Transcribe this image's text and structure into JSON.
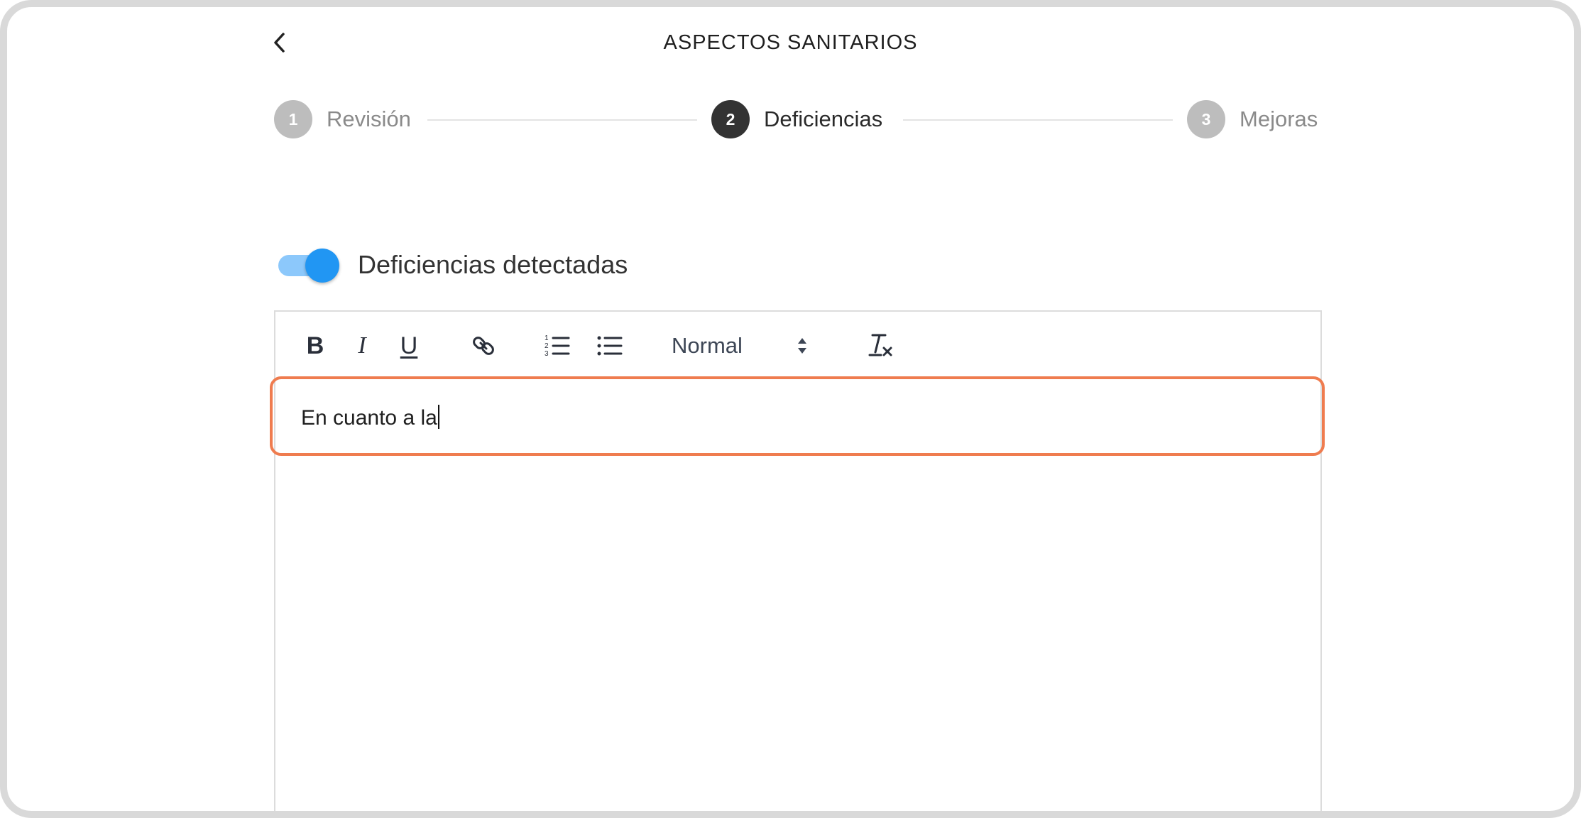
{
  "header": {
    "title": "ASPECTOS SANITARIOS",
    "back_icon": "chevron-left-icon"
  },
  "stepper": {
    "steps": [
      {
        "number": "1",
        "label": "Revisión",
        "state": "inactive"
      },
      {
        "number": "2",
        "label": "Deficiencias",
        "state": "active"
      },
      {
        "number": "3",
        "label": "Mejoras",
        "state": "inactive"
      }
    ]
  },
  "toggle": {
    "label": "Deficiencias detectadas",
    "checked": "on"
  },
  "editor": {
    "toolbar": {
      "bold_label": "B",
      "italic_label": "I",
      "underline_label": "U",
      "link_icon": "link-icon",
      "ordered_list_icon": "ordered-list-icon",
      "bullet_list_icon": "bullet-list-icon",
      "header_value": "Normal",
      "clean_icon": "clear-format-icon"
    },
    "content": "En cuanto a la"
  },
  "colors": {
    "accent": "#2196f3",
    "toggle_track": "#8cc8fb",
    "active_step": "#333333",
    "inactive_step": "#bdbdbd",
    "highlight": "#ef7c4f"
  }
}
